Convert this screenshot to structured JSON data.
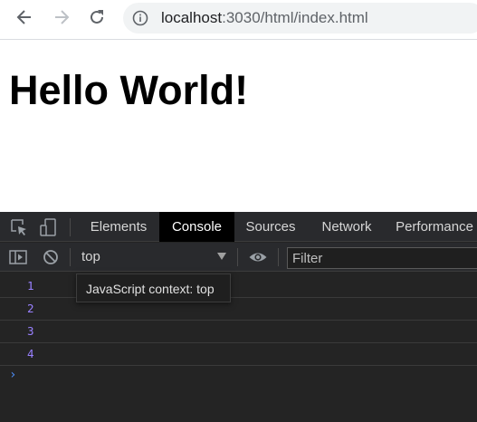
{
  "browser": {
    "url_host": "localhost",
    "url_rest": ":3030/html/index.html",
    "icons": {
      "back": "arrow-left-icon",
      "forward": "arrow-right-icon",
      "reload": "reload-icon",
      "site_info": "info-icon"
    }
  },
  "page": {
    "heading": "Hello World!"
  },
  "devtools": {
    "tabs": [
      {
        "label": "Elements",
        "active": false
      },
      {
        "label": "Console",
        "active": true
      },
      {
        "label": "Sources",
        "active": false
      },
      {
        "label": "Network",
        "active": false
      },
      {
        "label": "Performance",
        "active": false
      }
    ],
    "console_bar": {
      "context": "top",
      "filter_placeholder": "Filter"
    },
    "tooltip": "JavaScript context: top",
    "log_entries": [
      "1",
      "2",
      "3",
      "4"
    ],
    "prompt": "›",
    "colors": {
      "panel_bg": "#242424",
      "toolbar_bg": "#292a2d",
      "active_tab_bg": "#000000",
      "log_number": "#9980ff",
      "prompt": "#4c8cf5"
    }
  }
}
